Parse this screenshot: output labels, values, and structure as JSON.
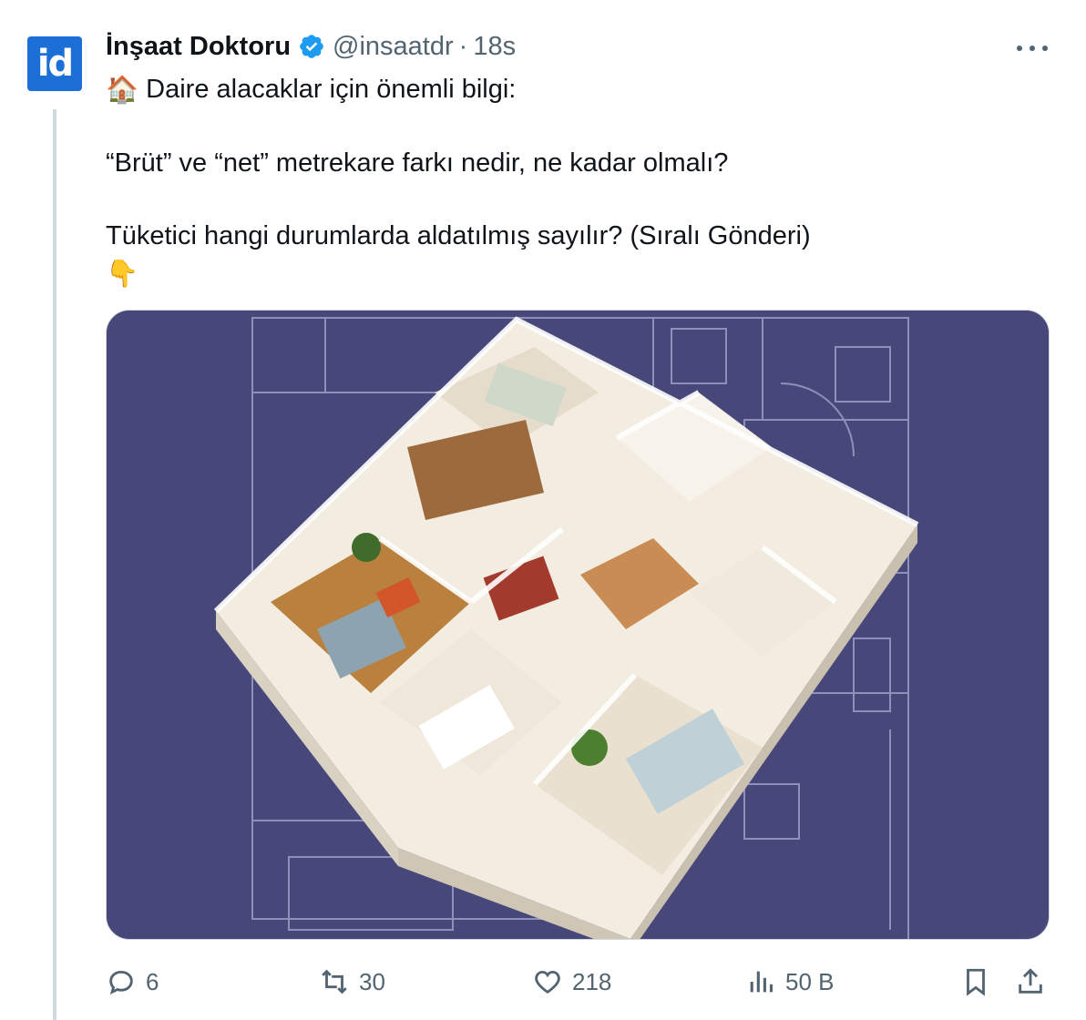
{
  "tweet": {
    "avatar_text": "id",
    "author": {
      "display_name": "İnşaat Doktoru",
      "handle": "@insaatdr",
      "separator": "·",
      "time": "18s",
      "verified": true
    },
    "text_lines": [
      "Daire alacaklar için önemli bilgi:",
      "“Brüt” ve “net” metrekare farkı nedir, ne kadar olmalı?",
      "Tüketici hangi durumlarda aldatılmış sayılır? (Sıralı Gönderi)"
    ],
    "emojis": {
      "house": "🏠",
      "point_down": "👇"
    },
    "media": {
      "icon": "apartment-floor-plan-3d-image",
      "background_color": "#474879"
    },
    "actions": {
      "reply_count": "6",
      "retweet_count": "30",
      "like_count": "218",
      "views_count": "50 B"
    }
  },
  "colors": {
    "primary_text": "#0f1419",
    "secondary_text": "#536471",
    "verified_blue": "#1d9bf0",
    "avatar_blue": "#1d6fd8",
    "thread_line": "#cfd9de"
  }
}
